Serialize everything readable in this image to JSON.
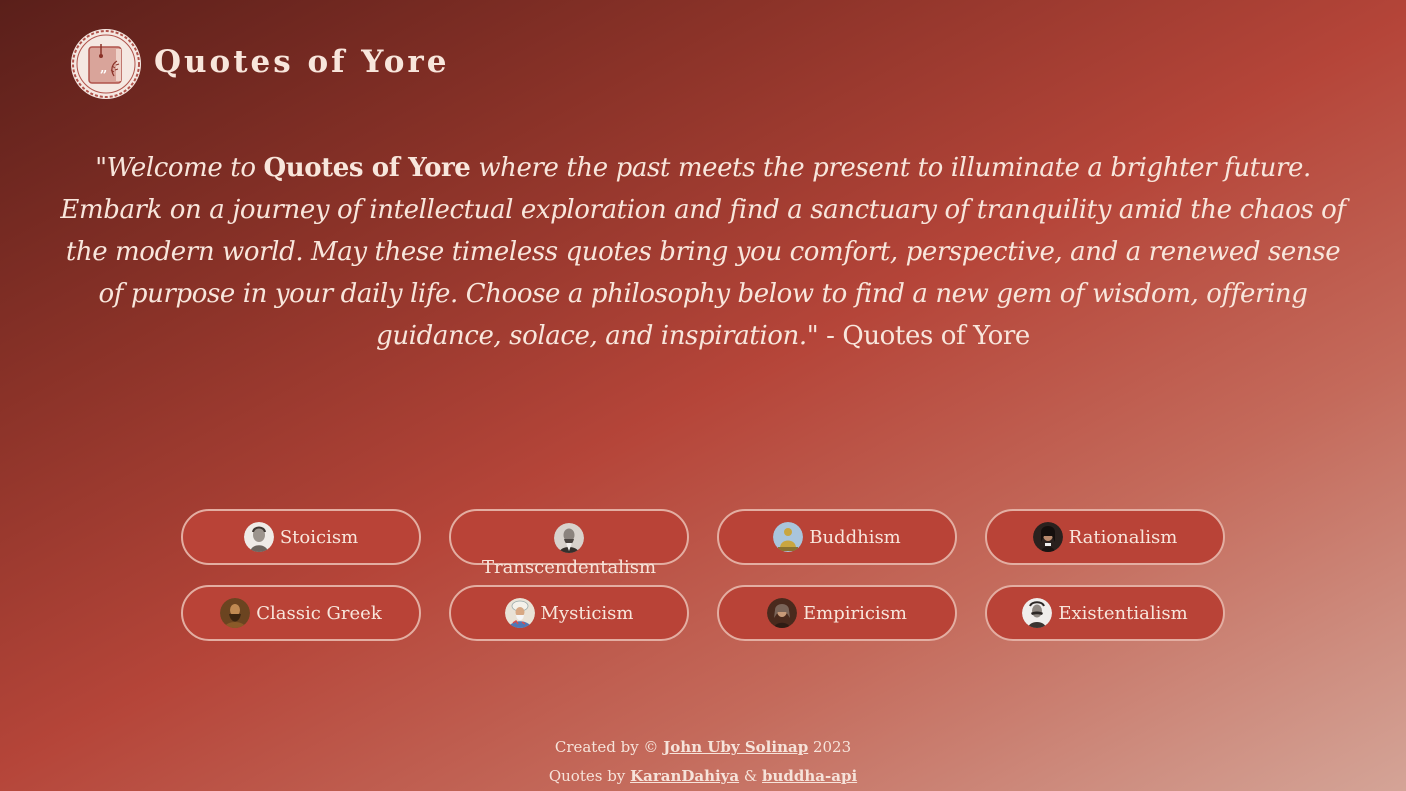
{
  "header": {
    "logo_icon": "quote-book-medallion-icon",
    "title": "Quotes of Yore"
  },
  "welcome": {
    "open": "\"Welcome to ",
    "brand": "Quotes of Yore",
    "body": " where the past meets the present to illuminate a brighter future. Embark on a journey of intellectual exploration and find a sanctuary of tranquility amid the chaos of the modern world. May these timeless quotes bring you comfort, perspective, and a renewed sense of purpose in your daily life. Choose a philosophy below to find a new gem of wisdom, offering guidance, solace, and inspiration.\"",
    "attribution": " - Quotes of Yore"
  },
  "philosophies": [
    {
      "label": "Stoicism",
      "icon": "stoic-portrait-icon",
      "color": "#e9e4df"
    },
    {
      "label": "Transcendentalism",
      "icon": "transcendentalist-portrait-icon",
      "color": "#cfc8c2"
    },
    {
      "label": "Buddhism",
      "icon": "buddha-statue-icon",
      "color": "#c9a640"
    },
    {
      "label": "Rationalism",
      "icon": "rationalist-portrait-icon",
      "color": "#2a211e"
    },
    {
      "label": "Classic Greek",
      "icon": "greek-philosopher-icon",
      "color": "#6b4420"
    },
    {
      "label": "Mysticism",
      "icon": "mystic-portrait-icon",
      "color": "#4f78b7"
    },
    {
      "label": "Empiricism",
      "icon": "empiricist-portrait-icon",
      "color": "#5b3526"
    },
    {
      "label": "Existentialism",
      "icon": "existentialist-portrait-icon",
      "color": "#bdb8b4"
    }
  ],
  "footer": {
    "created_prefix": "Created by © ",
    "author_link": "John Uby Solinap",
    "year": " 2023",
    "quotes_prefix": "Quotes by ",
    "source_link_1": "KaranDahiya",
    "ampersand": " & ",
    "source_link_2": "buddha-api"
  },
  "colors": {
    "button_bg": "#b94337",
    "button_border": "#e3aea2",
    "text": "#f8e6dc"
  }
}
